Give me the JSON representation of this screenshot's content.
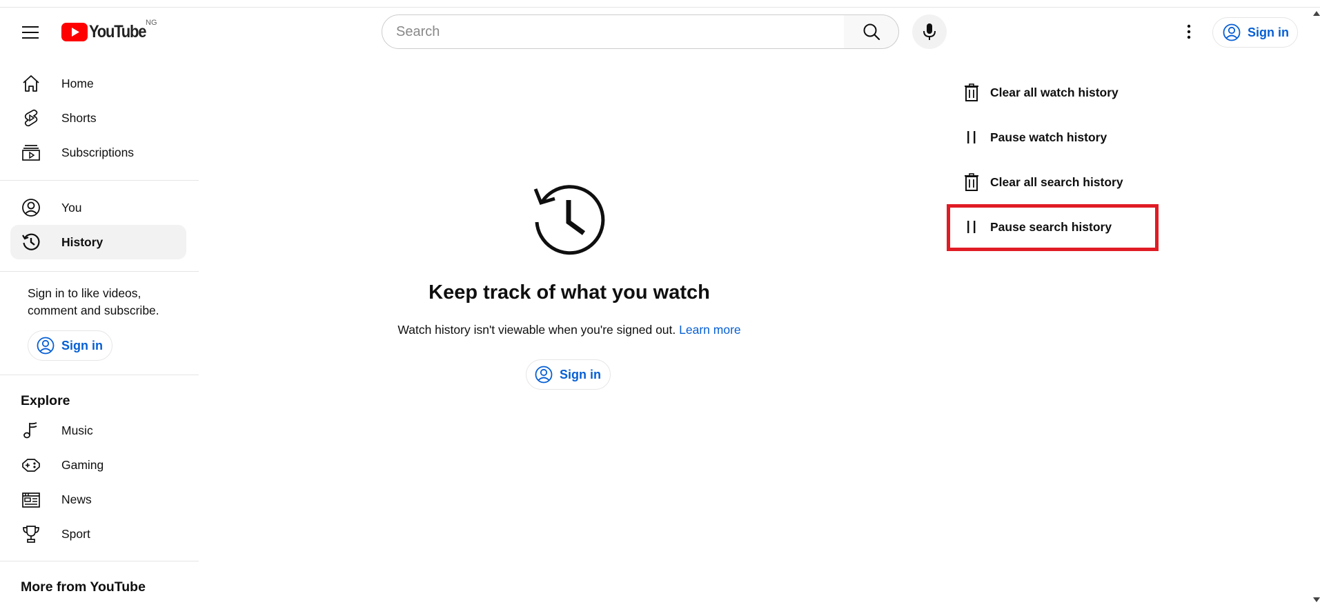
{
  "masthead": {
    "logo_text": "YouTube",
    "country_code": "NG",
    "search_placeholder": "Search",
    "sign_in_label": "Sign in",
    "brand_color": "#ff0000",
    "link_color": "#065fd4"
  },
  "sidebar": {
    "primary": [
      {
        "label": "Home",
        "icon": "home-icon"
      },
      {
        "label": "Shorts",
        "icon": "shorts-icon"
      },
      {
        "label": "Subscriptions",
        "icon": "subscriptions-icon"
      }
    ],
    "you_section": [
      {
        "label": "You",
        "icon": "account-circle-icon"
      },
      {
        "label": "History",
        "icon": "history-icon",
        "active": true
      }
    ],
    "sign_in_prompt": "Sign in to like videos, comment and subscribe.",
    "sign_in_label": "Sign in",
    "explore_title": "Explore",
    "explore": [
      {
        "label": "Music",
        "icon": "music-icon"
      },
      {
        "label": "Gaming",
        "icon": "gaming-icon"
      },
      {
        "label": "News",
        "icon": "news-icon"
      },
      {
        "label": "Sport",
        "icon": "trophy-icon"
      }
    ],
    "more_title": "More from YouTube"
  },
  "main": {
    "empty_title": "Keep track of what you watch",
    "empty_subtitle": "Watch history isn't viewable when you're signed out.",
    "learn_more": "Learn more",
    "sign_in_label": "Sign in"
  },
  "actions": [
    {
      "label": "Clear all watch history",
      "icon": "trash-icon"
    },
    {
      "label": "Pause watch history",
      "icon": "pause-icon"
    },
    {
      "label": "Clear all search history",
      "icon": "trash-icon"
    },
    {
      "label": "Pause search history",
      "icon": "pause-icon",
      "highlighted": true,
      "highlight_color": "#e01b24"
    }
  ]
}
